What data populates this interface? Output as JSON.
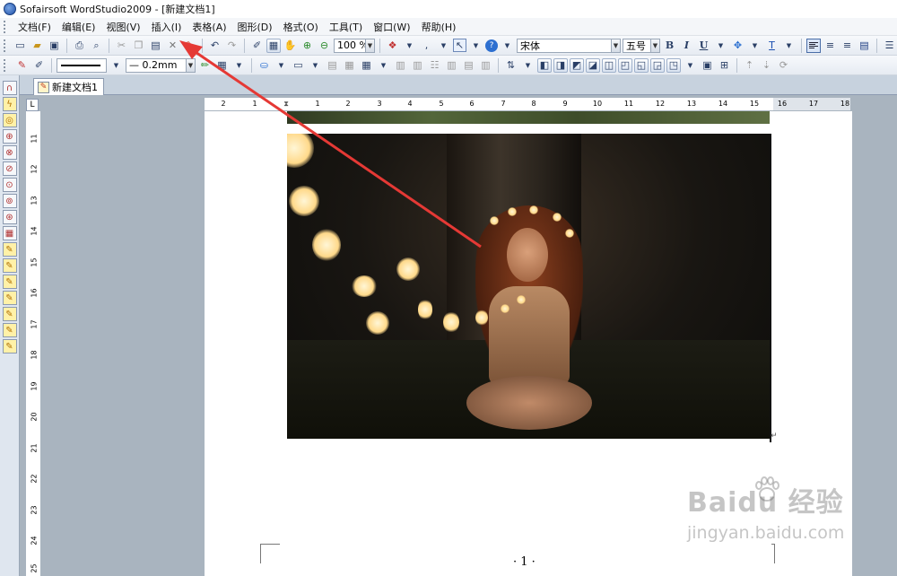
{
  "window": {
    "title": "Sofairsoft WordStudio2009 - [新建文档1]"
  },
  "menu": {
    "items": [
      "文档(F)",
      "编辑(E)",
      "视图(V)",
      "插入(I)",
      "表格(A)",
      "图形(D)",
      "格式(O)",
      "工具(T)",
      "窗口(W)",
      "帮助(H)"
    ]
  },
  "toolbar1": {
    "zoom": "100 %",
    "font_name": "宋体",
    "font_size": "五号",
    "bold": "B",
    "italic": "I",
    "underline": "U"
  },
  "toolbar2": {
    "line_width": "0.2mm"
  },
  "document_tab": {
    "label": "新建文档1"
  },
  "ruler": {
    "corner": "L",
    "horizontal_ticks": [
      "2",
      "1",
      "1",
      "2",
      "3",
      "4",
      "5",
      "6",
      "7",
      "8",
      "9",
      "10",
      "11",
      "12",
      "13",
      "14",
      "15",
      "16",
      "17",
      "18"
    ],
    "vertical_ticks": [
      "11",
      "12",
      "13",
      "14",
      "15",
      "16",
      "17",
      "18",
      "19",
      "20",
      "21",
      "22",
      "23",
      "24",
      "25"
    ]
  },
  "page": {
    "page_number": "· 1 ·",
    "paragraph_mark": "↵"
  },
  "watermark": {
    "main": "Baidu 经验",
    "sub": "jingyan.baidu.com"
  },
  "colors": {
    "annotation_arrow": "#e53935",
    "workspace": "#a9b4bf"
  }
}
